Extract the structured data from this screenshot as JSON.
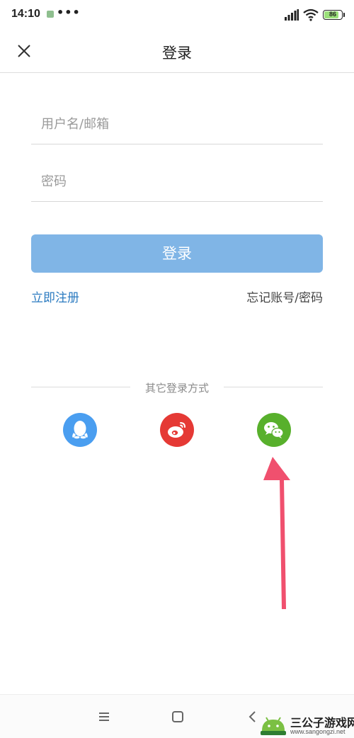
{
  "status_bar": {
    "time": "14:10",
    "notification_icon": "app-notification-icon",
    "more_indicator": "•••",
    "battery_level": "86",
    "battery_fraction": 0.86,
    "battery_color": "#9be07a"
  },
  "header": {
    "title": "登录",
    "close_icon": "close-icon"
  },
  "form": {
    "username_placeholder": "用户名/邮箱",
    "password_placeholder": "密码",
    "login_label": "登录",
    "login_button_color": "#80b5e6",
    "register_label": "立即注册",
    "forgot_label": "忘记账号/密码",
    "link_color": "#2a7ac0"
  },
  "other_login": {
    "label": "其它登录方式",
    "providers": [
      {
        "id": "qq",
        "icon": "qq-penguin-icon",
        "color": "#4a9ef0"
      },
      {
        "id": "weibo",
        "icon": "weibo-icon",
        "color": "#e53935"
      },
      {
        "id": "wechat",
        "icon": "wechat-icon",
        "color": "#58b02c"
      }
    ]
  },
  "annotation": {
    "icon": "red-arrow-pointing-up",
    "color": "#f0506e"
  },
  "nav_bar": {
    "menu_icon": "menu-icon",
    "home_icon": "home-square-icon",
    "back_icon": "back-chevron-icon"
  },
  "watermark": {
    "name": "三公子游戏网",
    "url": "www.sangongzi.net"
  }
}
